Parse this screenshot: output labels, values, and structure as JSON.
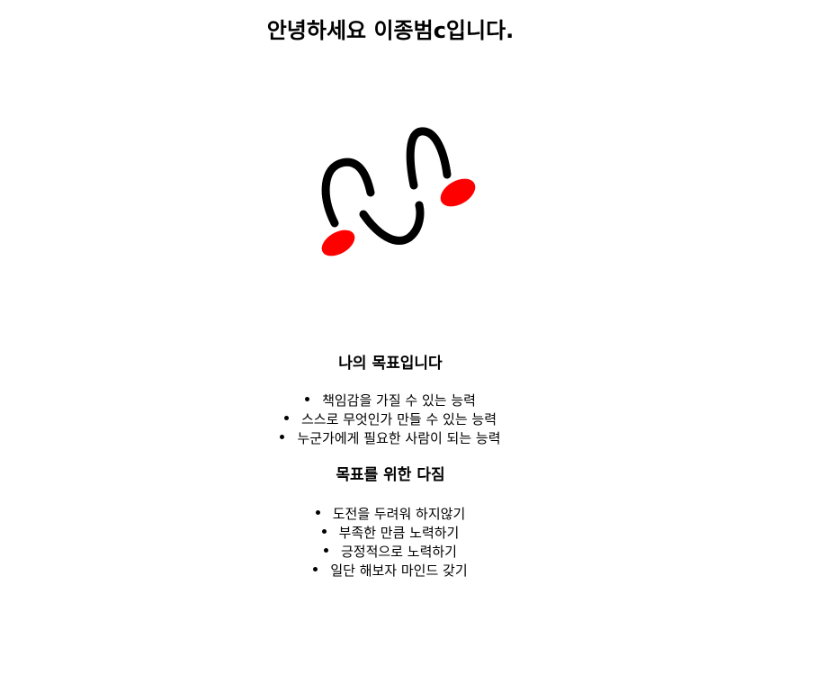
{
  "title": "안녕하세요 이종범c입니다.",
  "logo": {
    "stroke_color": "#000000",
    "accent_color": "#ff0000"
  },
  "goals": {
    "heading": "나의 목표입니다",
    "items": [
      "책임감을 가질 수 있는 능력",
      "스스로 무엇인가 만들 수 있는 능력",
      "누군가에게 필요한 사람이 되는 능력"
    ]
  },
  "resolutions": {
    "heading": "목표를 위한 다짐",
    "items": [
      "도전을 두려워 하지않기",
      "부족한 만큼 노력하기",
      "긍정적으로 노력하기",
      "일단 해보자 마인드 갖기"
    ]
  }
}
